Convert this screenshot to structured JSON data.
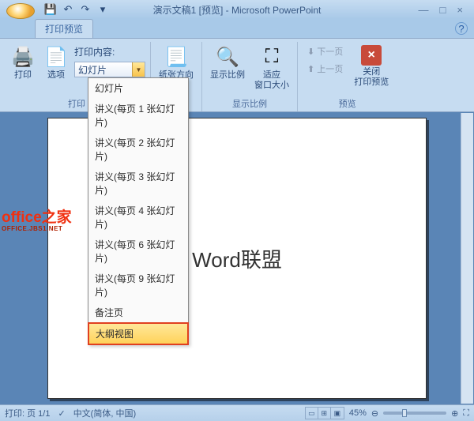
{
  "titlebar": {
    "title": "演示文稿1 [预览] - Microsoft PowerPoint"
  },
  "qat": {
    "save": "💾",
    "undo": "↶",
    "redo": "↷",
    "more": "▾"
  },
  "win": {
    "min": "—",
    "max": "□",
    "close": "×"
  },
  "tabs": {
    "print_preview": "打印预览"
  },
  "ribbon": {
    "print_group_label": "打印",
    "print_btn": "打印",
    "options_btn": "选项",
    "print_content_label": "打印内容:",
    "combo_value": "幻灯片",
    "orientation_btn": "纸张方向",
    "zoom_btn": "显示比例",
    "fit_btn": "适应\n窗口大小",
    "zoom_group_label": "显示比例",
    "prev_page": "下一页",
    "next_page": "上一页",
    "close_btn": "关闭\n打印预览",
    "preview_group_label": "预览"
  },
  "dropdown": {
    "items": [
      "幻灯片",
      "讲义(每页 1 张幻灯片)",
      "讲义(每页 2 张幻灯片)",
      "讲义(每页 3 张幻灯片)",
      "讲义(每页 4 张幻灯片)",
      "讲义(每页 6 张幻灯片)",
      "讲义(每页 9 张幻灯片)",
      "备注页",
      "大纲视图"
    ]
  },
  "slide": {
    "content": "Word联盟"
  },
  "statusbar": {
    "page_label": "打印: 页 1/1",
    "lang": "中文(简体, 中国)",
    "zoom_pct": "45%"
  },
  "watermark": {
    "main": "office之家",
    "sub": "OFFICE.JBS1.NET"
  }
}
